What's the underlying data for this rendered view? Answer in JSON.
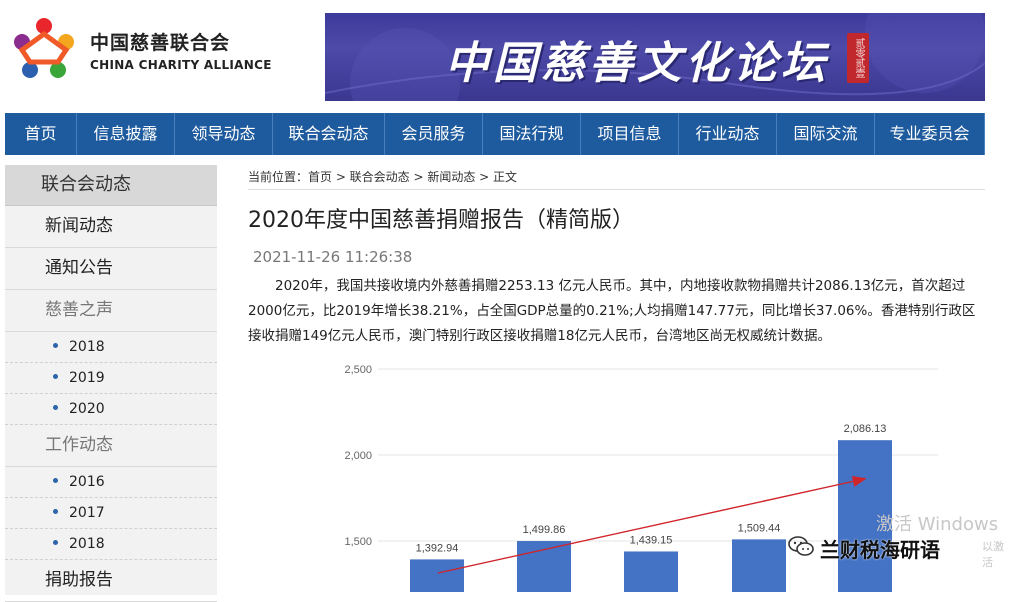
{
  "header": {
    "org_name_cn": "中国慈善联合会",
    "org_name_en": "CHINA CHARITY ALLIANCE",
    "banner_title": "中国慈善文化论坛",
    "banner_seal": "贰零贰壹"
  },
  "nav": [
    "首页",
    "信息披露",
    "领导动态",
    "联合会动态",
    "会员服务",
    "国法行规",
    "项目信息",
    "行业动态",
    "国际交流",
    "专业委员会"
  ],
  "sidebar": {
    "heading": "联合会动态",
    "items": [
      {
        "label": "新闻动态",
        "type": "item"
      },
      {
        "label": "通知公告",
        "type": "item"
      },
      {
        "label": "慈善之声",
        "type": "group"
      },
      {
        "label": "2018",
        "type": "sub"
      },
      {
        "label": "2019",
        "type": "sub"
      },
      {
        "label": "2020",
        "type": "sub"
      },
      {
        "label": "工作动态",
        "type": "group"
      },
      {
        "label": "2016",
        "type": "sub"
      },
      {
        "label": "2017",
        "type": "sub"
      },
      {
        "label": "2018",
        "type": "sub"
      },
      {
        "label": "捐助报告",
        "type": "item"
      }
    ]
  },
  "breadcrumb": "当前位置：首页 > 联合会动态 > 新闻动态 > 正文",
  "article": {
    "title": "2020年度中国慈善捐赠报告（精简版）",
    "date": "2021-11-26 11:26:38",
    "paragraph": "2020年，我国共接收境内外慈善捐赠2253.13 亿元人民币。其中，内地接收款物捐赠共计2086.13亿元，首次超过2000亿元，比2019年增长38.21%，占全国GDP总量的0.21%;人均捐赠147.77元，同比增长37.06%。香港特别行政区接收捐赠149亿元人民币，澳门特别行政区接收捐赠18亿元人民币，台湾地区尚无权威统计数据。"
  },
  "chart_data": {
    "type": "bar",
    "values": [
      1392.94,
      1499.86,
      1439.15,
      1509.44,
      2086.13
    ],
    "value_labels": [
      "1,392.94",
      "1,499.86",
      "1,439.15",
      "1,509.44",
      "2,086.13"
    ],
    "yticks": [
      "2,500",
      "2,000",
      "1,500"
    ],
    "ylim": [
      1350,
      2500
    ],
    "bar_color": "#4472c4",
    "trend_arrow_color": "#d0252b"
  },
  "overlays": {
    "watermark": "激活 Windows",
    "watermark_small": "以激活",
    "wechat_label": "兰财税海研语"
  }
}
